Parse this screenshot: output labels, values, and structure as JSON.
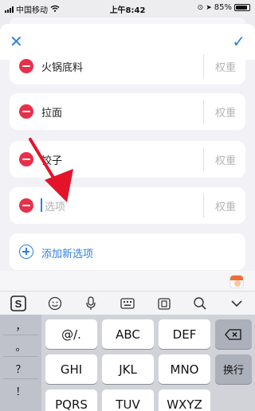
{
  "status_bar": {
    "carrier": "中国移动",
    "time": "上午8:42",
    "battery": "85%"
  },
  "header": {
    "close_icon": "close-icon",
    "confirm_icon": "checkmark-icon"
  },
  "options": [
    {
      "label": "火锅底料",
      "weight_placeholder": "权重"
    },
    {
      "label": "拉面",
      "weight_placeholder": "权重"
    },
    {
      "label": "饺子",
      "weight_placeholder": "权重"
    },
    {
      "label": "",
      "placeholder": "选项",
      "weight_placeholder": "权重"
    }
  ],
  "add_option": {
    "label": "添加新选项"
  },
  "keyboard": {
    "toolbar_icons": [
      "sogou-logo-icon",
      "emoji-icon",
      "microphone-icon",
      "keyboard-icon",
      "clipboard-icon",
      "search-icon",
      "collapse-icon"
    ],
    "left_column": [
      "，",
      "。",
      "？",
      "！"
    ],
    "row1": [
      "@/.",
      "ABC",
      "DEF"
    ],
    "row2": [
      "GHI",
      "JKL",
      "MNO"
    ],
    "row3": [
      "PQRS",
      "TUV",
      "WXYZ"
    ],
    "delete_icon": "backspace-icon",
    "return_label": "换行"
  },
  "colors": {
    "accent": "#2f7fe0",
    "danger": "#e8304a",
    "arrow": "#e5132a"
  }
}
